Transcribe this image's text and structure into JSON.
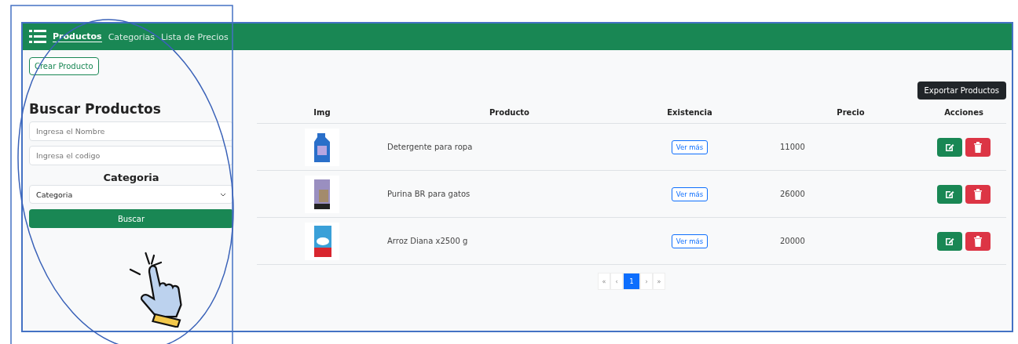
{
  "nav": {
    "links": [
      {
        "label": "Productos",
        "selected": true
      },
      {
        "label": "Categorias",
        "selected": false
      },
      {
        "label": "Lista de Precios",
        "selected": false
      }
    ]
  },
  "create_button": "Crear Producto",
  "search": {
    "title": "Buscar Productos",
    "name_placeholder": "Ingresa el Nombre",
    "code_placeholder": "Ingresa el codigo",
    "category_label": "Categoria",
    "category_value": "Categoria",
    "button": "Buscar"
  },
  "export_button": "Exportar Productos",
  "table": {
    "columns": [
      "Img",
      "Producto",
      "Existencia",
      "Precio",
      "Acciones"
    ],
    "rows": [
      {
        "product": "Detergente para ropa",
        "stock_button": "Ver más",
        "price": "11000",
        "kind": "bottle"
      },
      {
        "product": "Purina BR para gatos",
        "stock_button": "Ver más",
        "price": "26000",
        "kind": "bag"
      },
      {
        "product": "Arroz Diana x2500 g",
        "stock_button": "Ver más",
        "price": "20000",
        "kind": "pack"
      }
    ]
  },
  "pagination": [
    {
      "label": "«",
      "selected": false
    },
    {
      "label": "‹",
      "selected": false
    },
    {
      "label": "1",
      "selected": true
    },
    {
      "label": "›",
      "selected": false
    },
    {
      "label": "»",
      "selected": false
    }
  ]
}
